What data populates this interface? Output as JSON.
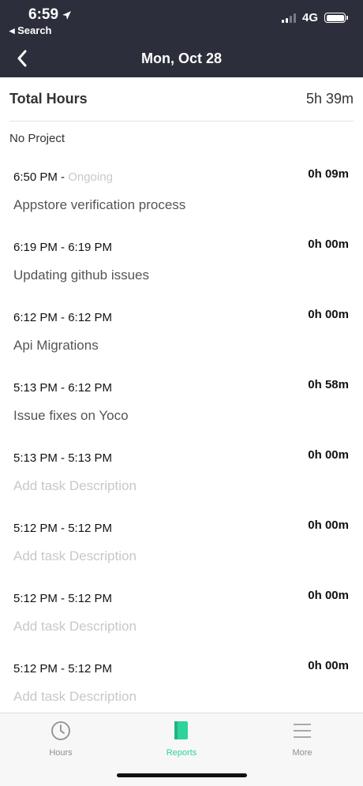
{
  "status_bar": {
    "time": "6:59",
    "back_label": "◂ Search",
    "network": "4G"
  },
  "header": {
    "title": "Mon, Oct 28"
  },
  "summary": {
    "label": "Total Hours",
    "value": "5h 39m"
  },
  "project_label": "No Project",
  "entries": [
    {
      "time": "6:50 PM - ",
      "ongoing": "Ongoing",
      "duration": "0h 09m",
      "description": "Appstore verification process",
      "placeholder": false
    },
    {
      "time": "6:19 PM - 6:19 PM",
      "duration": "0h 00m",
      "description": "Updating github issues",
      "placeholder": false
    },
    {
      "time": "6:12 PM - 6:12 PM",
      "duration": "0h 00m",
      "description": "Api Migrations",
      "placeholder": false
    },
    {
      "time": "5:13 PM - 6:12 PM",
      "duration": "0h 58m",
      "description": "Issue fixes on Yoco",
      "placeholder": false
    },
    {
      "time": "5:13 PM - 5:13 PM",
      "duration": "0h 00m",
      "description": "Add task Description",
      "placeholder": true
    },
    {
      "time": "5:12 PM - 5:12 PM",
      "duration": "0h 00m",
      "description": "Add task Description",
      "placeholder": true
    },
    {
      "time": "5:12 PM - 5:12 PM",
      "duration": "0h 00m",
      "description": "Add task Description",
      "placeholder": true
    },
    {
      "time": "5:12 PM - 5:12 PM",
      "duration": "0h 00m",
      "description": "Add task Description",
      "placeholder": true
    }
  ],
  "tabs": [
    {
      "label": "Hours",
      "icon": "clock-icon",
      "active": false
    },
    {
      "label": "Reports",
      "icon": "reports-icon",
      "active": true
    },
    {
      "label": "More",
      "icon": "menu-icon",
      "active": false
    }
  ],
  "colors": {
    "header_bg": "#2c2f3b",
    "accent": "#2ed39a",
    "placeholder": "#c8c8c8"
  }
}
